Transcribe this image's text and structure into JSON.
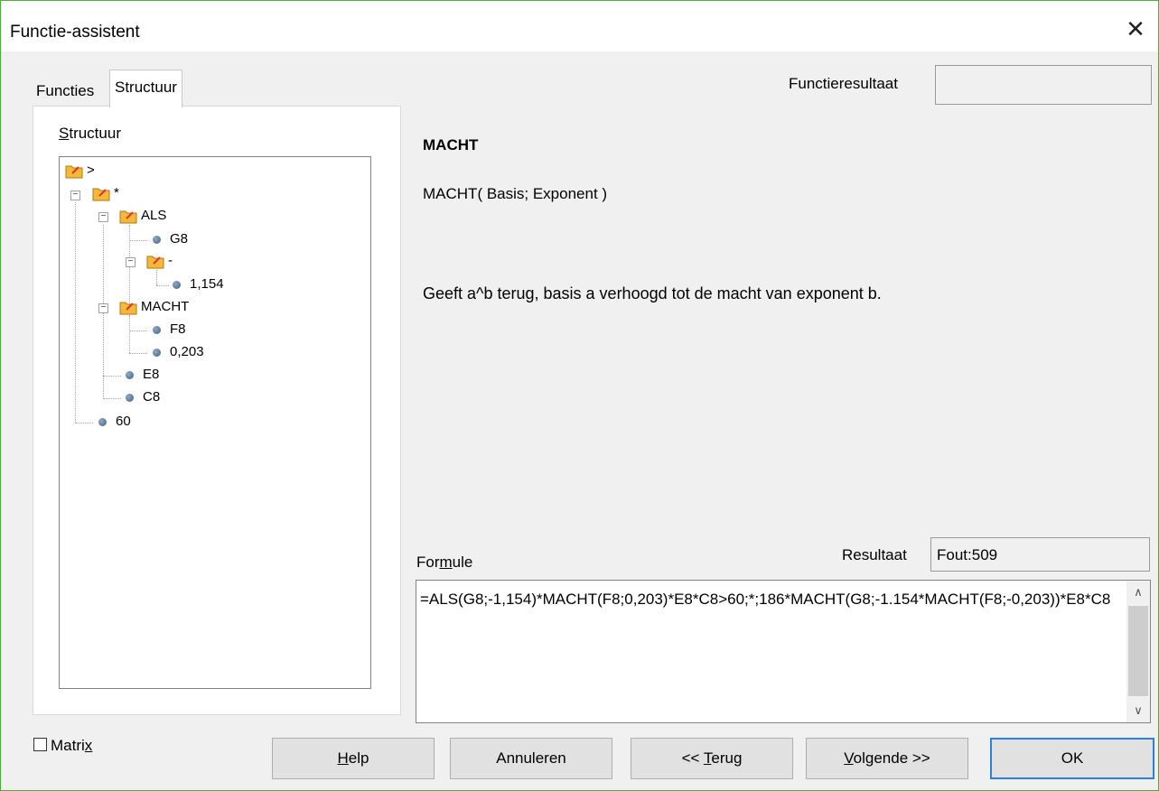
{
  "window": {
    "title": "Functie-assistent",
    "close_glyph": "✕"
  },
  "tabs": [
    {
      "label": "Functies",
      "active": false
    },
    {
      "label": "Structuur",
      "active": true
    }
  ],
  "structure": {
    "label_first": "S",
    "label_rest": "tructuur",
    "tree": [
      {
        "label": ">",
        "type": "folder"
      },
      {
        "label": "*",
        "type": "folder",
        "expanded": true
      },
      {
        "label": "ALS",
        "type": "folder",
        "expanded": true
      },
      {
        "label": "G8",
        "type": "leaf"
      },
      {
        "label": "-",
        "type": "folder",
        "expanded": true
      },
      {
        "label": "1,154",
        "type": "leaf"
      },
      {
        "label": "MACHT",
        "type": "folder",
        "expanded": true
      },
      {
        "label": "F8",
        "type": "leaf"
      },
      {
        "label": "0,203",
        "type": "leaf"
      },
      {
        "label": "E8",
        "type": "leaf"
      },
      {
        "label": "C8",
        "type": "leaf"
      },
      {
        "label": "60",
        "type": "leaf"
      }
    ]
  },
  "function_result": {
    "label": "Functieresultaat",
    "value": ""
  },
  "function": {
    "name": "MACHT",
    "signature": "MACHT( Basis; Exponent )",
    "description": "Geeft a^b terug, basis a verhoogd tot de macht van exponent b."
  },
  "formula": {
    "label_pre": "For",
    "label_u": "m",
    "label_post": "ule",
    "value": "=ALS(G8;-1,154)*MACHT(F8;0,203)*E8*C8>60;*;186*MACHT(G8;-1.154*MACHT(F8;-0,203))*E8*C8"
  },
  "result": {
    "label": "Resultaat",
    "value": "Fout:509"
  },
  "matrix": {
    "label_pre": "Matri",
    "label_u": "x",
    "checked": false
  },
  "buttons": {
    "help_u": "H",
    "help_rest": "elp",
    "cancel": "Annuleren",
    "back_pre": "<< ",
    "back_u": "T",
    "back_rest": "erug",
    "next_u": "V",
    "next_rest": "olgende >>",
    "ok": "OK"
  },
  "colors": {
    "window_border": "#4cae3c",
    "ok_border": "#2f7fd8"
  }
}
